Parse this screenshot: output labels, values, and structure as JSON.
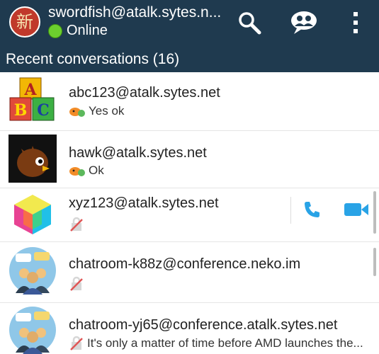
{
  "account": {
    "name": "swordfish@atalk.sytes.n...",
    "status": "Online",
    "avatar_glyph": "新",
    "status_color": "#6ccf2e"
  },
  "toolbar": {
    "search_icon": "search-icon",
    "contacts_icon": "contacts-bubble-icon",
    "menu_icon": "overflow-menu-icon"
  },
  "section": {
    "title": "Recent conversations (16)"
  },
  "conversations": [
    {
      "name": "abc123@atalk.sytes.net",
      "last_message": "Yes ok",
      "avatar": "abc-blocks"
    },
    {
      "name": "hawk@atalk.sytes.net",
      "last_message": "Ok",
      "avatar": "hawk"
    },
    {
      "name": "xyz123@atalk.sytes.net",
      "last_message": "",
      "avatar": "color-cube"
    },
    {
      "name": "chatroom-k88z@conference.neko.im",
      "last_message": "",
      "avatar": "chatroom"
    },
    {
      "name": "chatroom-yj65@conference.atalk.sytes.net",
      "last_message": "It's only a matter of time before AMD launches the...",
      "avatar": "chatroom"
    }
  ],
  "actions": {
    "call_icon": "phone-icon",
    "video_icon": "video-camera-icon"
  },
  "colors": {
    "appbar": "#1f3a4f",
    "accent": "#29a3e6"
  }
}
